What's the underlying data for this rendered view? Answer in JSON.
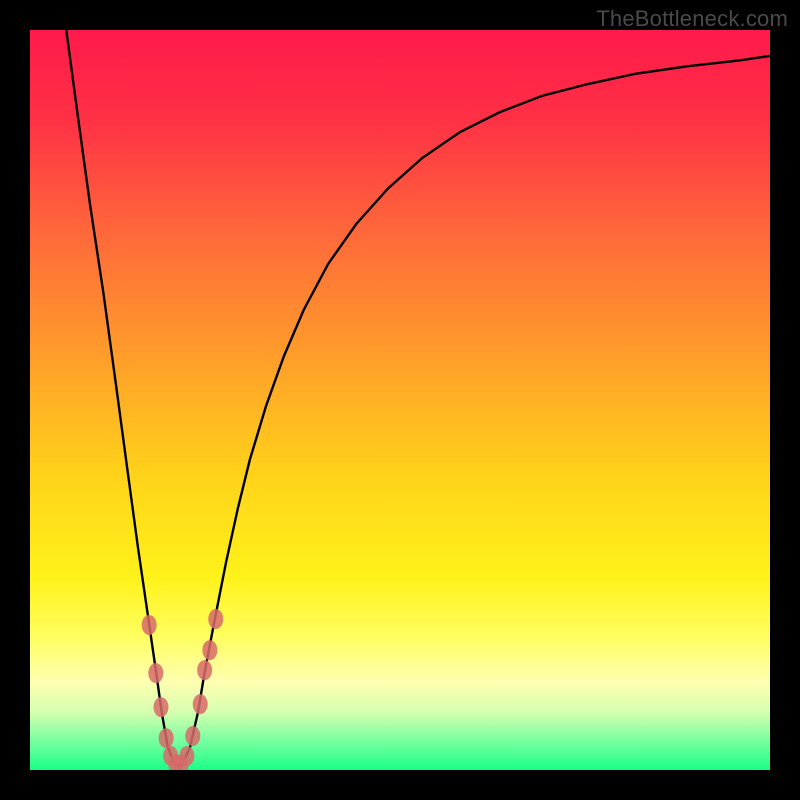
{
  "watermark": "TheBottleneck.com",
  "colors": {
    "frame": "#000000",
    "curve": "#000000",
    "marker": "#d86a6a",
    "gradient_stops": [
      {
        "offset": 0.0,
        "color": "#ff1a4b"
      },
      {
        "offset": 0.12,
        "color": "#ff3045"
      },
      {
        "offset": 0.28,
        "color": "#ff6a3a"
      },
      {
        "offset": 0.45,
        "color": "#ffa029"
      },
      {
        "offset": 0.6,
        "color": "#ffd21a"
      },
      {
        "offset": 0.74,
        "color": "#fff21a"
      },
      {
        "offset": 0.82,
        "color": "#ffff60"
      },
      {
        "offset": 0.88,
        "color": "#ffffb0"
      },
      {
        "offset": 0.92,
        "color": "#d8ffb0"
      },
      {
        "offset": 0.96,
        "color": "#7affa0"
      },
      {
        "offset": 1.0,
        "color": "#1aff88"
      }
    ]
  },
  "chart_data": {
    "type": "line",
    "title": "",
    "xlabel": "",
    "ylabel": "",
    "xlim": [
      0,
      100
    ],
    "ylim": [
      0,
      100
    ],
    "grid": false,
    "note": "Axis values are in percent of plot area; no tick labels are shown in the image. Values read from pixel positions.",
    "series": [
      {
        "name": "bottleneck-curve",
        "x": [
          4.9,
          6.5,
          8.1,
          9.9,
          11.6,
          13.2,
          14.6,
          15.9,
          17.0,
          17.8,
          18.6,
          19.5,
          20.4,
          21.6,
          22.7,
          23.6,
          24.9,
          26.5,
          28.1,
          29.7,
          31.9,
          34.3,
          37.0,
          40.3,
          44.1,
          48.4,
          53.0,
          58.1,
          63.5,
          69.2,
          75.4,
          81.9,
          88.8,
          96.0,
          100.0
        ],
        "y": [
          100.0,
          88.1,
          76.5,
          64.6,
          52.2,
          40.3,
          30.0,
          21.1,
          13.5,
          7.8,
          3.2,
          0.8,
          0.5,
          3.0,
          7.8,
          13.2,
          20.0,
          28.1,
          35.4,
          41.9,
          49.2,
          55.9,
          62.2,
          68.4,
          73.8,
          78.6,
          82.7,
          86.2,
          88.9,
          91.1,
          92.7,
          94.1,
          95.1,
          95.9,
          96.5
        ]
      }
    ],
    "markers": {
      "name": "highlighted-points",
      "points": [
        {
          "x": 16.1,
          "y": 19.6
        },
        {
          "x": 17.0,
          "y": 13.1
        },
        {
          "x": 17.7,
          "y": 8.5
        },
        {
          "x": 18.4,
          "y": 4.3
        },
        {
          "x": 19.0,
          "y": 1.9
        },
        {
          "x": 19.7,
          "y": 0.8
        },
        {
          "x": 20.4,
          "y": 0.7
        },
        {
          "x": 21.2,
          "y": 1.9
        },
        {
          "x": 22.0,
          "y": 4.6
        },
        {
          "x": 23.0,
          "y": 8.9
        },
        {
          "x": 23.6,
          "y": 13.5
        },
        {
          "x": 24.3,
          "y": 16.2
        },
        {
          "x": 25.1,
          "y": 20.4
        }
      ]
    }
  }
}
